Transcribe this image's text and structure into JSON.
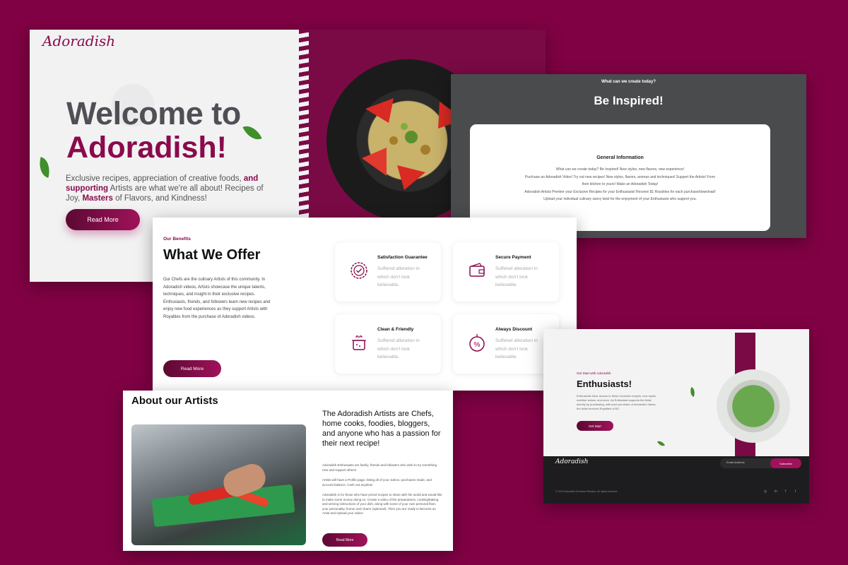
{
  "hero": {
    "logo": "Adoradish",
    "welcome": "Welcome to",
    "brand": "Adoradish!",
    "intro_1": "Exclusive recipes, appreciation of creative foods, ",
    "intro_bold_1": "and supporting",
    "intro_2": " Artists are what we're all about! Recipes of Joy, ",
    "intro_bold_2": "Masters",
    "intro_3": " of Flavors, and Kindness!",
    "button": "Read More"
  },
  "inspire": {
    "subtitle": "What can we create today?",
    "title": "Be Inspired!",
    "card_title": "General Information",
    "card_lines": [
      "What can we create today? Be Inspired! New styles, new flavors, new experience!",
      "Purchase an Adoradish Video! Try out new recipes! New styles, flavors, aromas and techniques! Support the Artists! From",
      "their kitchen to yours! Make an Adoradish Today!",
      "Adoradish Artists Premier your Exclusive Recipes for your Enthusiasts! Receive $1 Royalties for each purchase/download!",
      "Upload your individual culinary savvy twist for the enjoyment of your Enthusiasts who support you."
    ]
  },
  "offer": {
    "eyebrow": "Our Benefits",
    "title": "What We Offer",
    "body": "Our Chefs are the culinary Artists of this community. In Adoradish videos, Artists showcase the unique talents, techniques, and insight in their exclusive recipes.  Enthusiasts, friends, and followers learn new recipes and enjoy new food experiences as they support Artists with Royalties from the purchase of Adoradish videos.",
    "button": "Read More",
    "features": [
      {
        "title": "Satisfaction Guarantee",
        "desc": "Suffered alteration in which don't look believable."
      },
      {
        "title": "Secure Payment",
        "desc": "Suffered alteration in which don't look believable."
      },
      {
        "title": "Clean & Friendly",
        "desc": "Suffered alteration in which don't look believable."
      },
      {
        "title": "Always Discount",
        "desc": "Suffered alteration in which don't look believable."
      }
    ]
  },
  "artists": {
    "title": "About our Artists",
    "lead": "The Adoradish Artists are Chefs, home cooks, foodies, bloggers, and anyone who has a passion for their next recipe!",
    "p1": "Adoradish Enthusiasts are family, friends and followers who wish to try something new and support others!",
    "p2": "Artists will have a Profile page, listing all of your videos, purchases made, and account balance. Cash out anytime!",
    "p3": "Adoradish is for those who have prized recipes to share with the world and would like to make some money doing so. Create a video of the preparations, cooking/baking and serving instructions of your dish, along with some of your own personal flare, your personality, humor and charm (optional!). Then you are ready to Become an Artist and Upload your video!",
    "button": "Read More"
  },
  "enthusiasts": {
    "eyebrow": "Get Start with Adoradish",
    "title": "Enthusiasts!",
    "body": "Enthusiasts have access to these exclusive recipes, new styles, nutrition values, and more. As Enthusiast supports the Artist directly by purchasing, with each purchase of Adoradish videos, the Artist receives Royalties of $1!",
    "button": "Get Start",
    "footer_logo": "Adoradish",
    "email_placeholder": "Email Address",
    "subscribe": "Subscribe",
    "copyright": "© 2021 Adoradish Exclusive Recipes. All rights reserved.",
    "social": [
      "◎",
      "in",
      "f",
      "t"
    ]
  },
  "colors": {
    "background": "#800244",
    "accent": "#8a0a4c",
    "dark_gray": "#4a4b4d"
  }
}
